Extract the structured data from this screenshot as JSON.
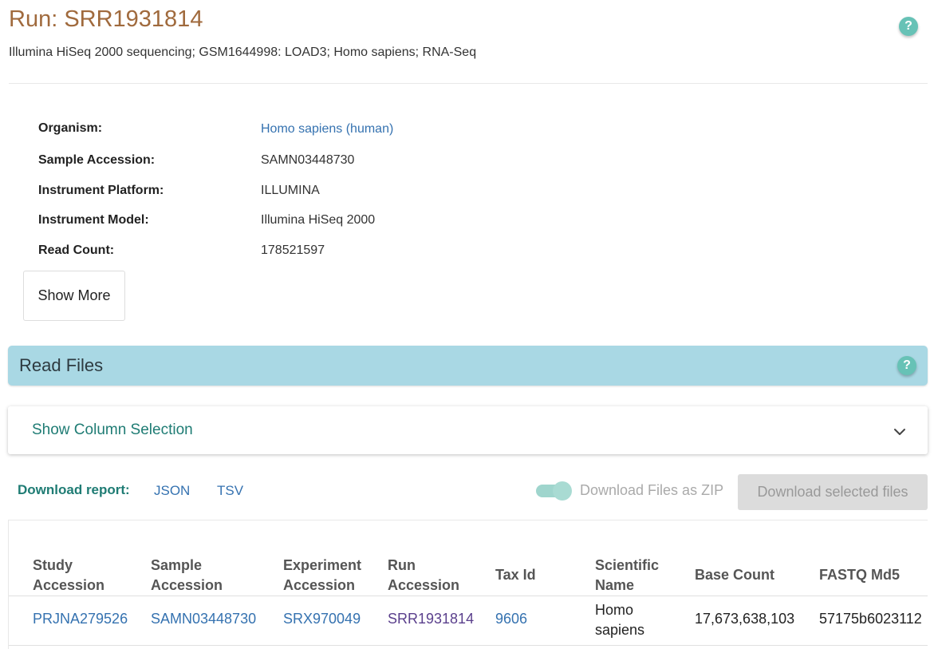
{
  "header": {
    "title": "Run: SRR1931814",
    "subtitle": "Illumina HiSeq 2000 sequencing; GSM1644998: LOAD3; Homo sapiens; RNA-Seq",
    "help_glyph": "?"
  },
  "metadata": [
    {
      "label": "Organism:",
      "value": "Homo sapiens (human)"
    },
    {
      "label": "Sample Accession:",
      "value": "SAMN03448730"
    },
    {
      "label": "Instrument Platform:",
      "value": "ILLUMINA"
    },
    {
      "label": "Instrument Model:",
      "value": "Illumina HiSeq 2000"
    },
    {
      "label": "Read Count:",
      "value": "178521597"
    }
  ],
  "show_more_label": "Show More",
  "read_files": {
    "title": "Read Files",
    "help_glyph": "?",
    "bar_color": "#a9d8e4"
  },
  "column_selection": {
    "label": "Show Column Selection",
    "icon": "chevron-down-icon"
  },
  "download": {
    "report_label": "Download report:",
    "json_label": "JSON",
    "tsv_label": "TSV",
    "zip_toggle_label": "Download Files as ZIP",
    "zip_toggle_on": true,
    "selected_button_label": "Download selected files"
  },
  "table": {
    "headers": [
      "Study Accession",
      "Sample Accession",
      "Experiment Accession",
      "Run Accession",
      "Tax Id",
      "Scientific Name",
      "Base Count",
      "FASTQ Md5"
    ],
    "rows": [
      {
        "study_accession": "PRJNA279526",
        "sample_accession": "SAMN03448730",
        "experiment_accession": "SRX970049",
        "run_accession": "SRR1931814",
        "tax_id": "9606",
        "scientific_name": "Homo sapiens",
        "base_count": "17,673,638,103",
        "fastq_md5": "57175b6023112"
      }
    ]
  },
  "colors": {
    "title": "#a06a3d",
    "accent_teal": "#1f7c74",
    "link": "#3572b0",
    "visited_link": "#5a3f8c",
    "help_icon": "#67c2b6"
  }
}
